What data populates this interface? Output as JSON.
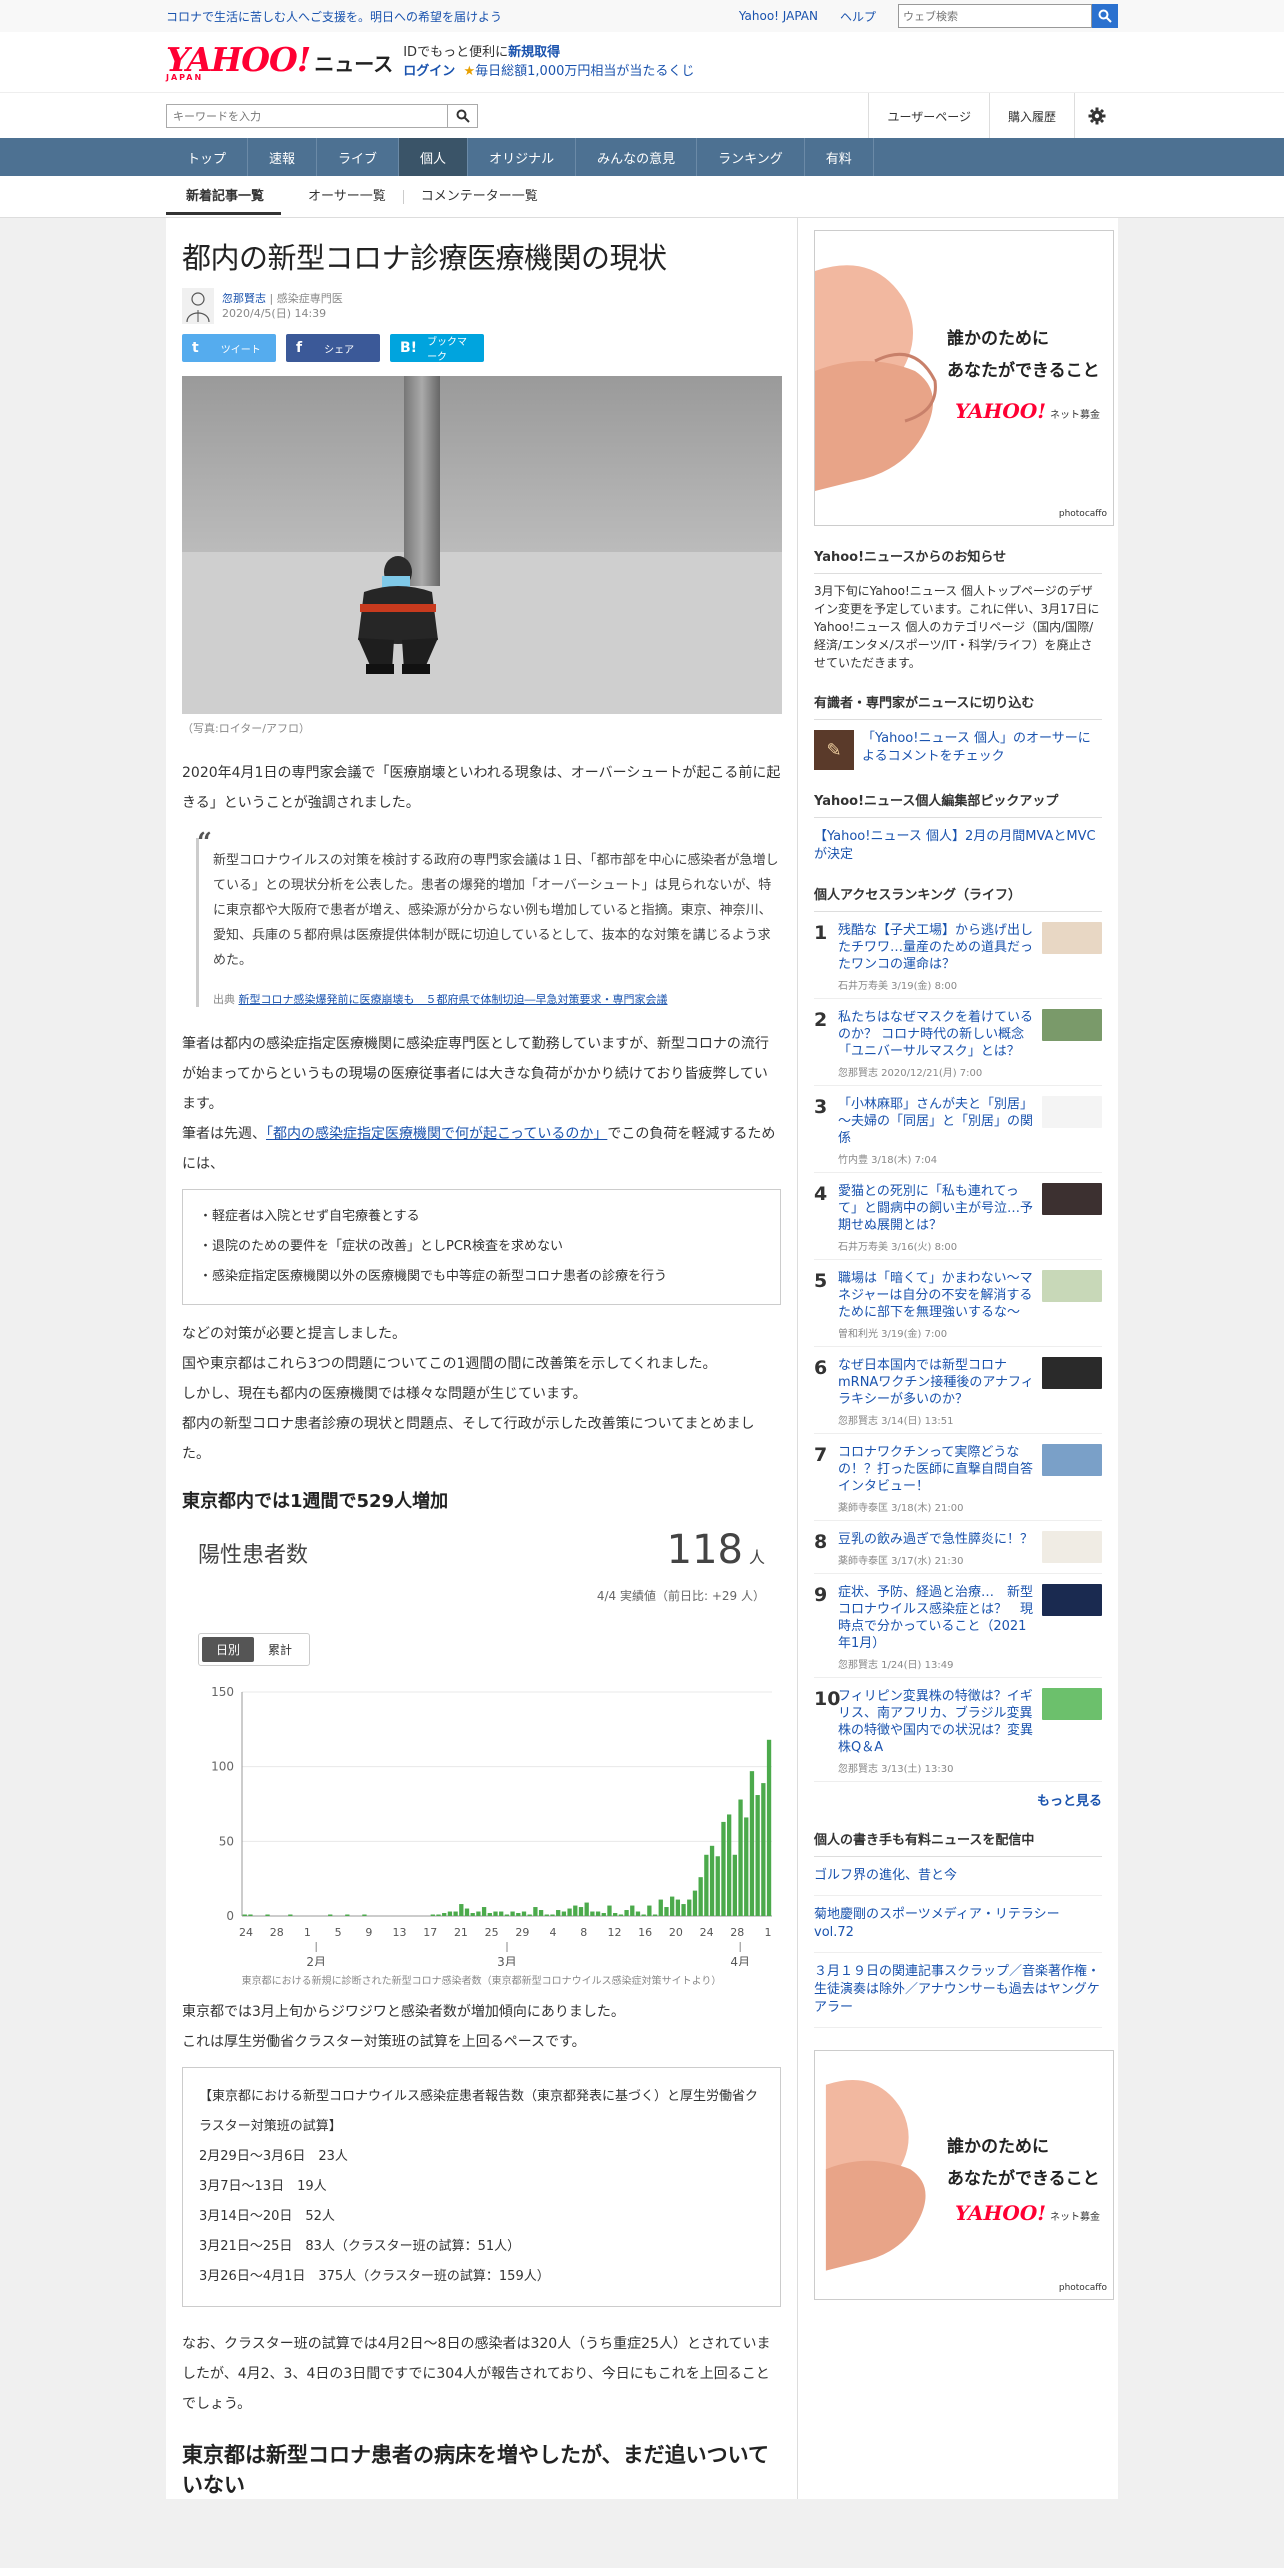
{
  "topbar": {
    "message": "コロナで生活に苦しむ人へご支援を。明日への希望を届けよう",
    "yahoo_japan": "Yahoo! JAPAN",
    "help": "ヘルプ",
    "search_placeholder": "ウェブ検索"
  },
  "header": {
    "logo": "YAHOO!",
    "logo_sub": "JAPAN",
    "news": "ニュース",
    "promo_line1_pre": "IDでもっと便利に",
    "promo_line1_link": "新規取得",
    "promo_line2_link": "ログイン",
    "promo_line2_rest": "毎日総額1,000万円相当が当たるくじ"
  },
  "searchbar": {
    "placeholder": "キーワードを入力",
    "user_page": "ユーザーページ",
    "purchase_history": "購入履歴"
  },
  "nav": {
    "items": [
      "トップ",
      "速報",
      "ライブ",
      "個人",
      "オリジナル",
      "みんなの意見",
      "ランキング",
      "有料"
    ],
    "active": "個人"
  },
  "subnav": {
    "items": [
      "新着記事一覧",
      "オーサー一覧",
      "コメンテーター一覧"
    ]
  },
  "article": {
    "title": "都内の新型コロナ診療医療機関の現状",
    "author": "忽那賢志",
    "author_role": "| 感染症専門医",
    "date": "2020/4/5(日) 14:39",
    "share_tweet": "ツイート",
    "share_fb": "シェア",
    "share_hb": "ブックマーク",
    "photo_caption": "（写真:ロイター/アフロ）",
    "p1": "2020年4月1日の専門家会議で「医療崩壊といわれる現象は、オーバーシュートが起こる前に起きる」ということが強調されました。",
    "quote": "新型コロナウイルスの対策を検討する政府の専門家会議は１日、「都市部を中心に感染者が急増している」との現状分析を公表した。患者の爆発的増加「オーバーシュート」は見られないが、特に東京都や大阪府で患者が増え、感染源が分からない例も増加していると指摘。東京、神奈川、愛知、兵庫の５都府県は医療提供体制が既に切迫しているとして、抜本的な対策を講じるよう求めた。",
    "quote_src_label": "出典",
    "quote_src_link": "新型コロナ感染爆発前に医療崩壊も　５都府県で体制切迫―早急対策要求・専門家会議",
    "p2": "筆者は都内の感染症指定医療機関に感染症専門医として勤務していますが、新型コロナの流行が始まってからというもの現場の医療従事者には大きな負荷がかかり続けており皆疲弊しています。",
    "p3_pre": "筆者は先週、",
    "p3_link": "「都内の感染症指定医療機関で何が起こっているのか」",
    "p3_post": "でこの負荷を軽減するためには、",
    "bullets": [
      "・軽症者は入院とせず自宅療養とする",
      "・退院のための要件を「症状の改善」としPCR検査を求めない",
      "・感染症指定医療機関以外の医療機関でも中等症の新型コロナ患者の診療を行う"
    ],
    "p4": "などの対策が必要と提言しました。",
    "p5": "国や東京都はこれら3つの問題についてこの1週間の間に改善策を示してくれました。",
    "p6": "しかし、現在も都内の医療機関では様々な問題が生じています。",
    "p7": "都内の新型コロナ患者診療の現状と問題点、そして行政が示した改善策についてまとめました。",
    "h2_1": "東京都内では1週間で529人増加",
    "stat_label": "陽性患者数",
    "stat_value": "118",
    "stat_unit": "人",
    "stat_note": "4/4 実績値（前日比: +29 人）",
    "toggle_daily": "日別",
    "toggle_cumulative": "累計",
    "chart_note": "東京都における新規に診断された新型コロナ感染者数（東京都新型コロナウイルス感染症対策サイトより）",
    "p8": "東京都では3月上旬からジワジワと感染者数が増加傾向にありました。",
    "p9": "これは厚生労働省クラスター対策班の試算を上回るペースです。",
    "box2_title": "【東京都における新型コロナウイルス感染症患者報告数（東京都発表に基づく）と厚生労働省クラスター対策班の試算】",
    "box2_items": [
      "2月29日～3月6日　23人",
      "3月7日～13日　19人",
      "3月14日～20日　52人",
      "3月21日～25日　83人（クラスター班の試算：51人）",
      "3月26日～4月1日　375人（クラスター班の試算：159人）"
    ],
    "p10": "なお、クラスター班の試算では4月2日～8日の感染者は320人（うち重症25人）とされていましたが、4月2、3、4日の3日間ですでに304人が報告されており、今日にもこれを上回ることでしょう。",
    "h2_2": "東京都は新型コロナ患者の病床を増やしたが、まだ追いついていない"
  },
  "chart_data": {
    "type": "bar",
    "title": "",
    "x_tick_labels": [
      "24",
      "28",
      "1",
      "5",
      "9",
      "13",
      "17",
      "21",
      "25",
      "29",
      "4",
      "8",
      "12",
      "16",
      "20",
      "24",
      "28",
      "1"
    ],
    "month_labels": [
      "2月",
      "3月",
      "4月"
    ],
    "ylim": [
      0,
      150
    ],
    "yticks": [
      0,
      50,
      100,
      150
    ],
    "color": "#4caa4c",
    "start_label": "1月24日",
    "end_label": "4月4日",
    "values": [
      1,
      1,
      0,
      0,
      1,
      0,
      0,
      0,
      1,
      0,
      0,
      0,
      0,
      0,
      0,
      1,
      0,
      0,
      1,
      0,
      0,
      1,
      0,
      0,
      0,
      0,
      0,
      0,
      0,
      0,
      0,
      0,
      0,
      1,
      1,
      2,
      3,
      3,
      8,
      5,
      2,
      3,
      6,
      2,
      3,
      3,
      1,
      3,
      2,
      3,
      1,
      6,
      4,
      1,
      1,
      4,
      3,
      5,
      7,
      6,
      9,
      3,
      3,
      2,
      7,
      2,
      1,
      4,
      7,
      3,
      1,
      7,
      1,
      11,
      6,
      13,
      11,
      8,
      11,
      17,
      26,
      41,
      47,
      40,
      63,
      68,
      41,
      78,
      66,
      97,
      81,
      89,
      118
    ]
  },
  "side": {
    "ad_text_1": "誰かのために",
    "ad_text_2": "あなたができること",
    "ad_logo": "YAHOO!",
    "ad_logo_sub": "ネット募金",
    "ad_credit": "photocaffo",
    "notice_h": "Yahoo!ニュースからのお知らせ",
    "notice_p": "3月下旬にYahoo!ニュース 個人トップページのデザイン変更を予定しています。これに伴い、3月17日にYahoo!ニュース 個人のカテゴリページ（国内/国際/経済/エンタメ/スポーツ/IT・科学/ライフ）を廃止させていただきます。",
    "experts_h": "有識者・専門家がニュースに切り込む",
    "experts_link": "「Yahoo!ニュース 個人」のオーサーによるコメントをチェック",
    "pickup_h": "Yahoo!ニュース個人編集部ピックアップ",
    "pickup_link": "【Yahoo!ニュース 個人】2月の月間MVAとMVCが決定",
    "ranking_h": "個人アクセスランキング（ライフ）",
    "ranking": [
      {
        "num": "1",
        "title": "残酷な【子犬工場】から逃げ出したチワワ…量産のための道具だったワンコの運命は？",
        "meta": "石井万寿美 3/19(金) 8:00",
        "color": "#e8d7c4"
      },
      {
        "num": "2",
        "title": "私たちはなぜマスクを着けているのか？ コロナ時代の新しい概念「ユニバーサルマスク」とは？",
        "meta": "忽那賢志 2020/12/21(月) 7:00",
        "color": "#7a9a6a"
      },
      {
        "num": "3",
        "title": "「小林麻耶」さんが夫と「別居」～夫婦の「同居」と「別居」の関係",
        "meta": "竹内豊 3/18(木) 7:04",
        "color": "#f4f4f4"
      },
      {
        "num": "4",
        "title": "愛猫との死別に「私も連れてって」と闘病中の飼い主が号泣…予期せぬ展開とは？",
        "meta": "石井万寿美 3/16(火) 8:00",
        "color": "#3c3030"
      },
      {
        "num": "5",
        "title": "職場は「暗くて」かまわない～マネジャーは自分の不安を解消するために部下を無理強いするな～",
        "meta": "曽和利光 3/19(金) 7:00",
        "color": "#c8d8b8"
      },
      {
        "num": "6",
        "title": "なぜ日本国内では新型コロナmRNAワクチン接種後のアナフィラキシーが多いのか？",
        "meta": "忽那賢志 3/14(日) 13:51",
        "color": "#2a2a2a"
      },
      {
        "num": "7",
        "title": "コロナワクチンって実際どうなの！？打った医師に直撃自問自答インタビュー！",
        "meta": "薬師寺泰匡 3/18(木) 21:00",
        "color": "#7aa0c8"
      },
      {
        "num": "8",
        "title": "豆乳の飲み過ぎで急性膵炎に！？",
        "meta": "薬師寺泰匡 3/17(水) 21:30",
        "color": "#f0ece4"
      },
      {
        "num": "9",
        "title": "症状、予防、経過と治療…　新型コロナウイルス感染症とは？　現時点で分かっていること（2021年1月）",
        "meta": "忽那賢志 1/24(日) 13:49",
        "color": "#1a2a50"
      },
      {
        "num": "10",
        "title": "フィリピン変異株の特徴は？イギリス、南アフリカ、ブラジル変異株の特徴や国内での状況は？変異株Q＆A",
        "meta": "忽那賢志 3/13(土) 13:30",
        "color": "#6cc06c"
      }
    ],
    "more": "もっと見る",
    "pay_h": "個人の書き手も有料ニュースを配信中",
    "pay_links": [
      "ゴルフ界の進化、昔と今",
      "菊地慶剛のスポーツメディア・リテラシー vol.72",
      "３月１９日の関連記事スクラップ／音楽著作権・生徒演奏は除外／アナウンサーも過去はヤングケアラー"
    ]
  },
  "colors": {
    "nav_bg": "#4d7192",
    "nav_active": "#3a5468",
    "link": "#1a53ae",
    "chart_bar": "#4caa4c",
    "brand_red": "#ff0033"
  }
}
